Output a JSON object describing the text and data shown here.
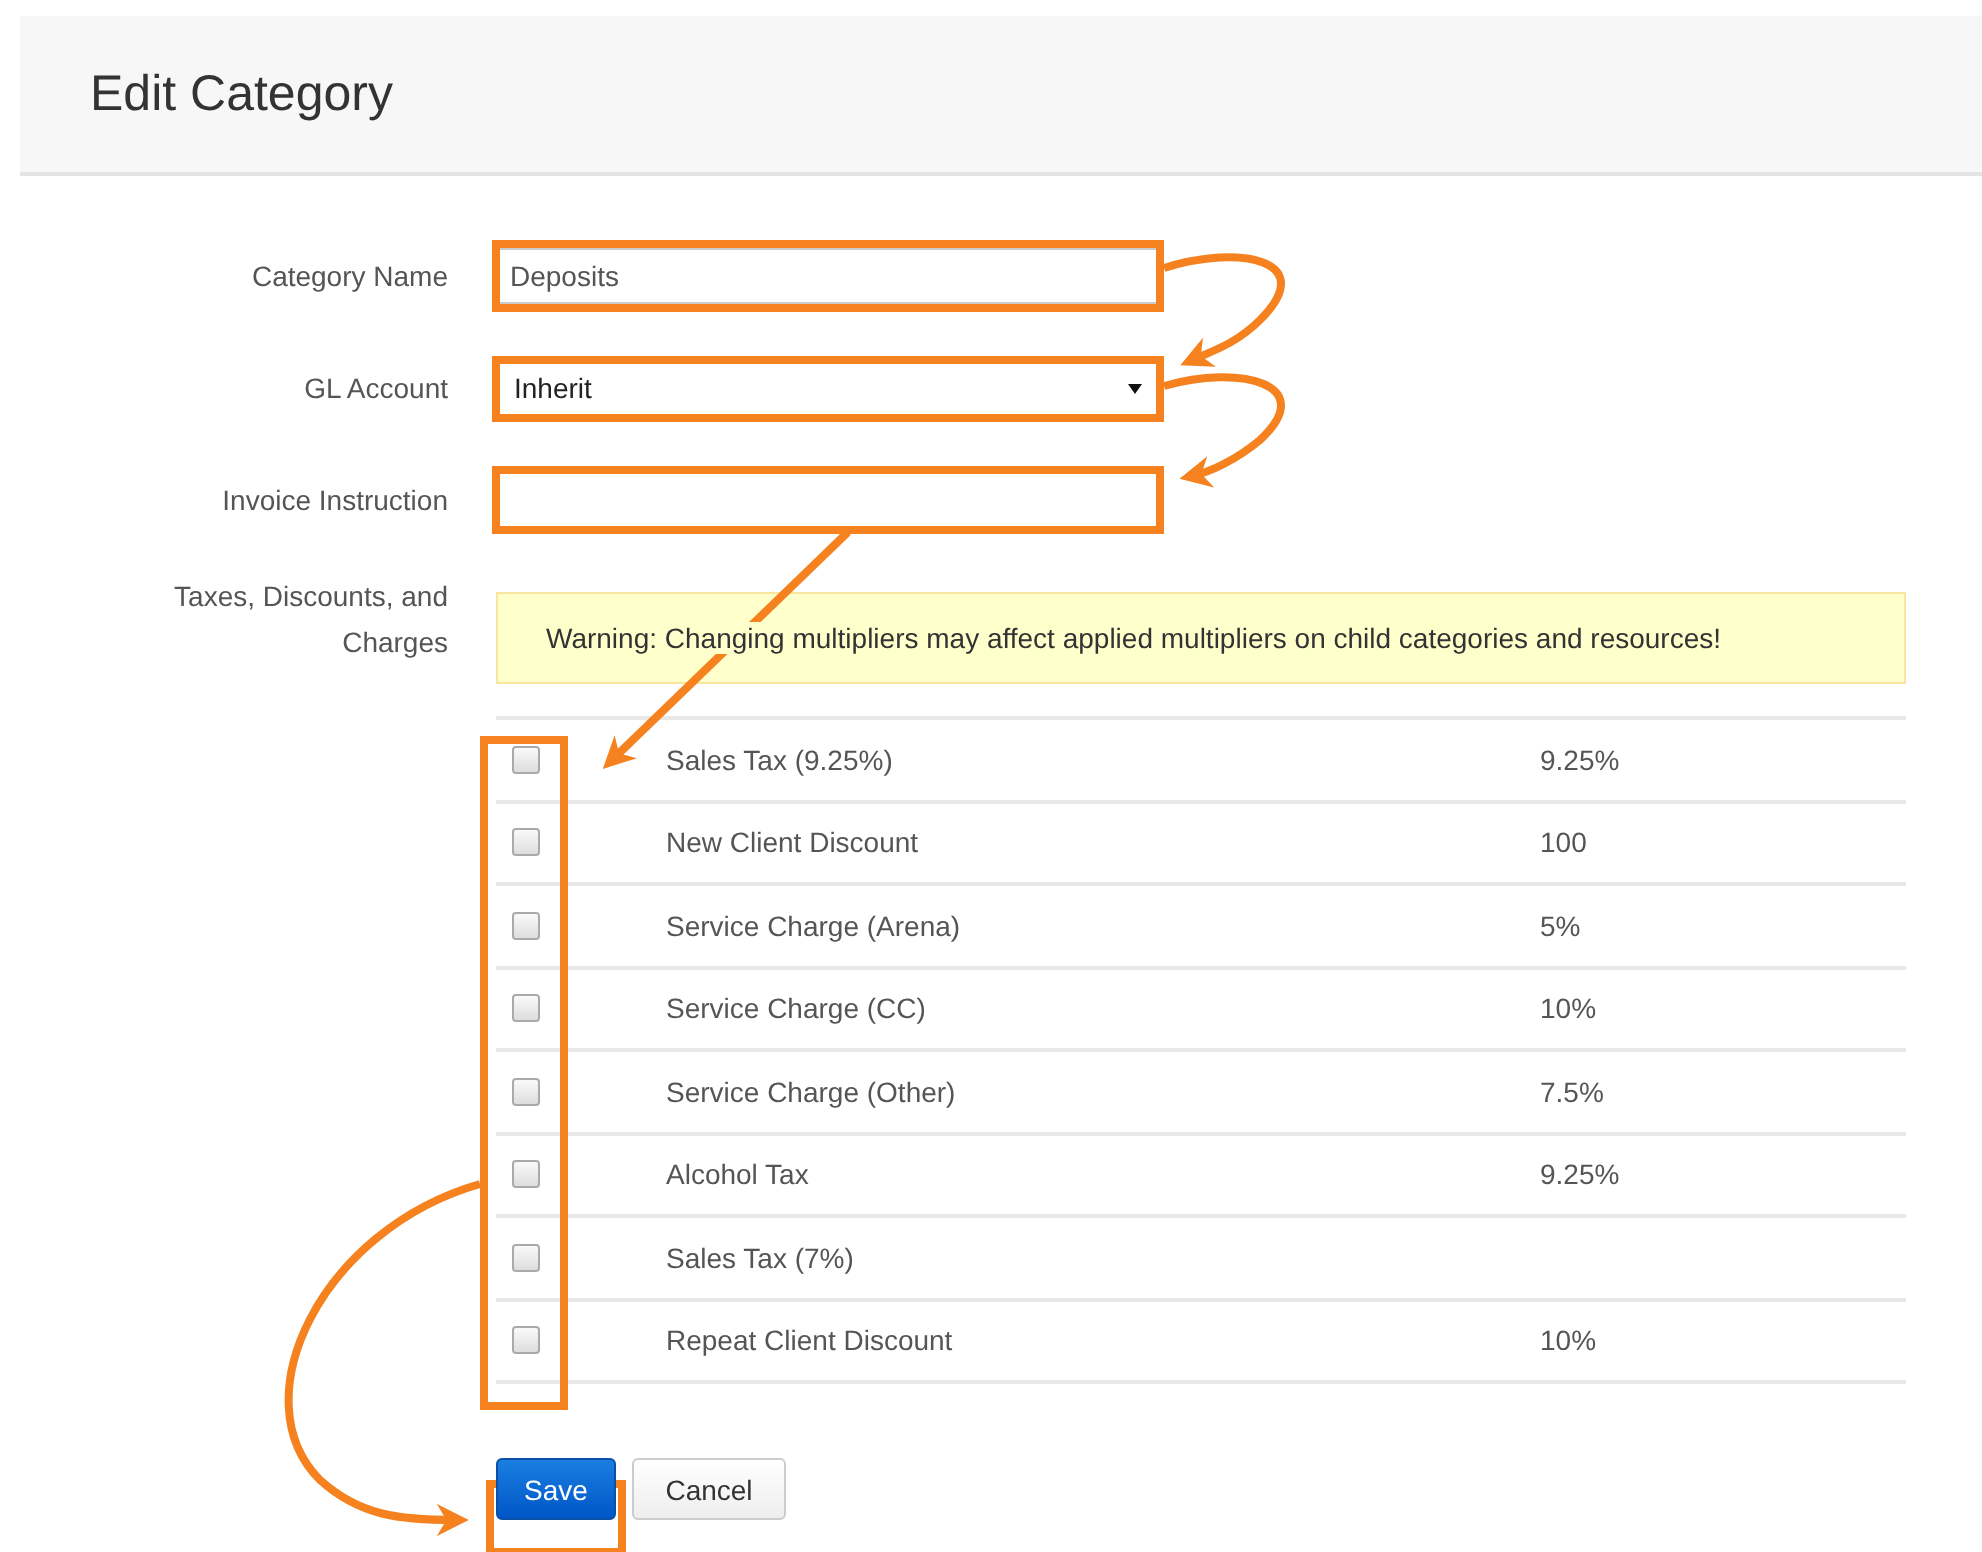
{
  "header": {
    "title": "Edit Category"
  },
  "fields": [
    {
      "label": "Category Name",
      "kind": "text",
      "value": "Deposits"
    },
    {
      "label": "GL Account",
      "kind": "select",
      "value": "Inherit"
    },
    {
      "label": "Invoice Instruction",
      "kind": "text"
    }
  ],
  "multipliers": {
    "label": "Taxes, Discounts, and Charges",
    "warning": "Warning: Changing multipliers may affect applied multipliers on child categories and resources!",
    "rows": [
      {
        "name": "Sales Tax (9.25%)",
        "value": "9.25%",
        "checked": false
      },
      {
        "name": "New Client Discount",
        "value": "100",
        "checked": false
      },
      {
        "name": "Service Charge (Arena)",
        "value": "5%",
        "checked": false
      },
      {
        "name": "Service Charge (CC)",
        "value": "10%",
        "checked": false
      },
      {
        "name": "Service Charge (Other)",
        "value": "7.5%",
        "checked": false
      },
      {
        "name": "Alcohol Tax",
        "value": "9.25%",
        "checked": false
      },
      {
        "name": "Sales Tax (7%)",
        "checked": false
      },
      {
        "name": "Repeat Client Discount",
        "value": "10%",
        "checked": false
      }
    ]
  },
  "buttons": [
    {
      "label": "Save",
      "kind": "primary"
    },
    {
      "label": "Cancel",
      "kind": "default"
    }
  ]
}
